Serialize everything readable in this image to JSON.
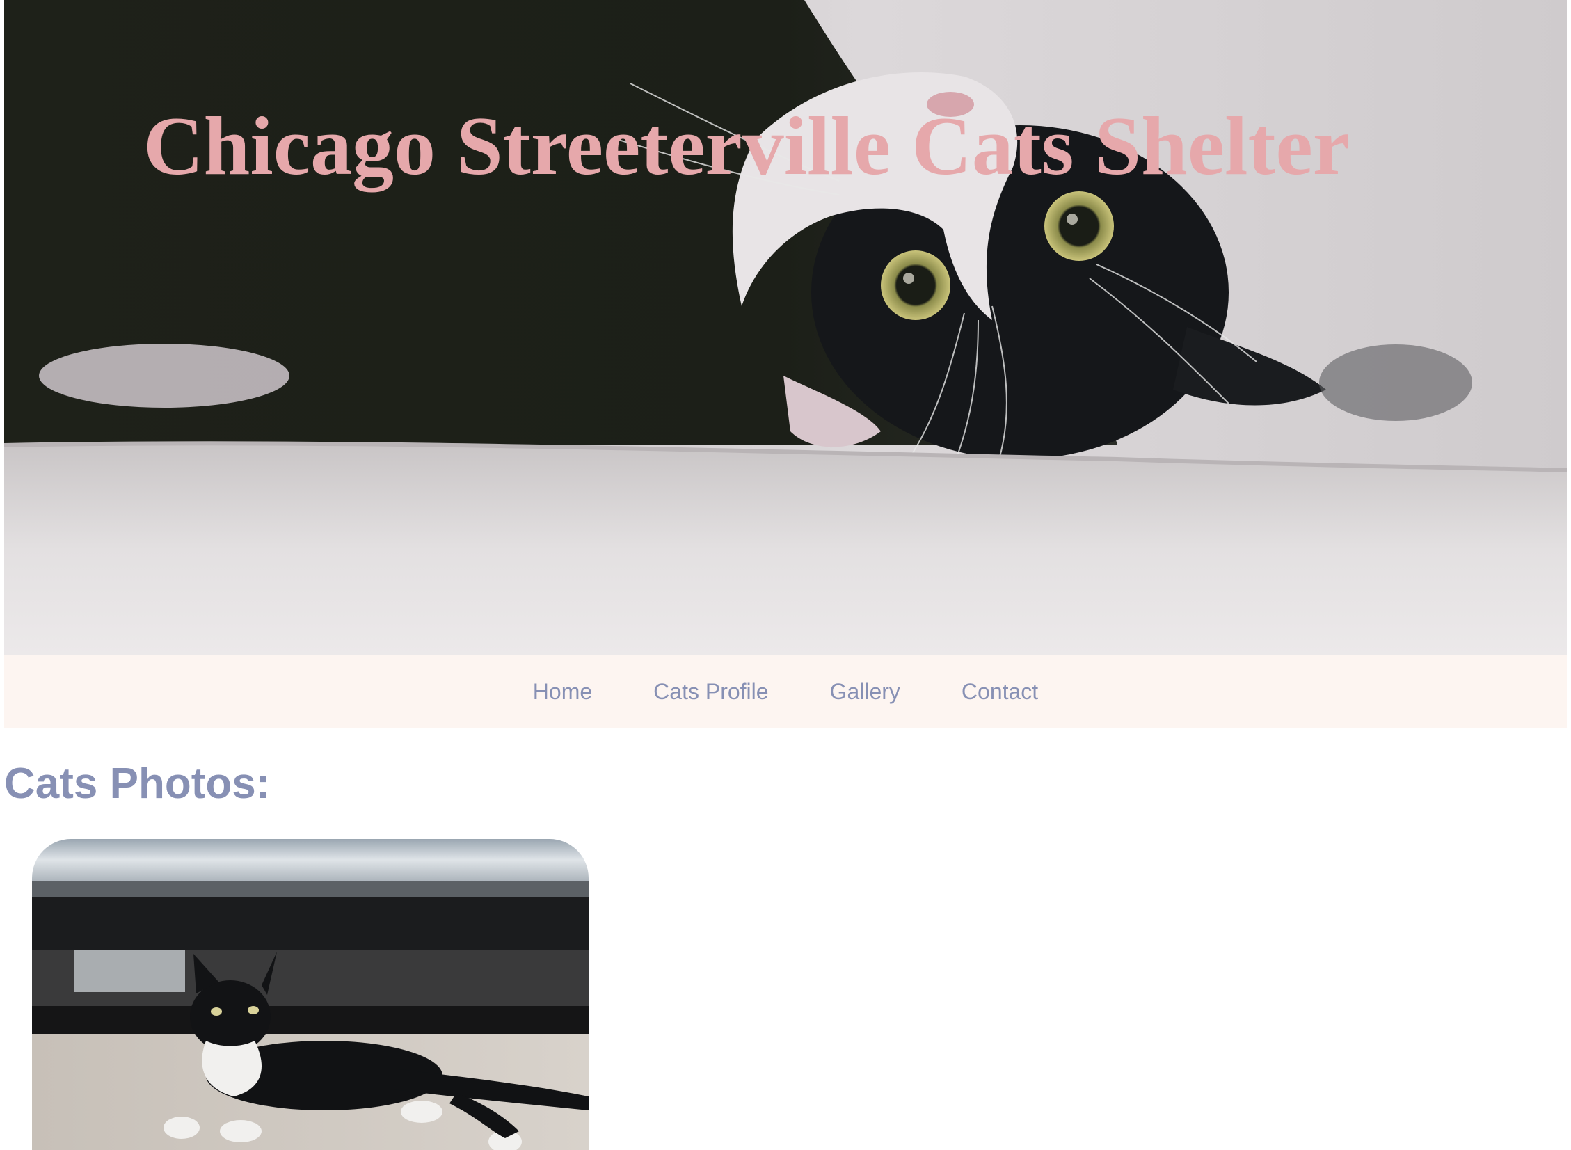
{
  "hero": {
    "title": "Chicago Streeterville Cats Shelter"
  },
  "nav": {
    "items": [
      {
        "label": "Home"
      },
      {
        "label": "Cats Profile"
      },
      {
        "label": "Gallery"
      },
      {
        "label": "Contact"
      }
    ]
  },
  "gallery": {
    "heading": "Cats Photos:"
  },
  "colors": {
    "title": "#e6a8ab",
    "nav_bg": "#fdf5f1",
    "nav_text": "#8790b4",
    "heading": "#8790b4",
    "page_bg": "#ffffff"
  }
}
